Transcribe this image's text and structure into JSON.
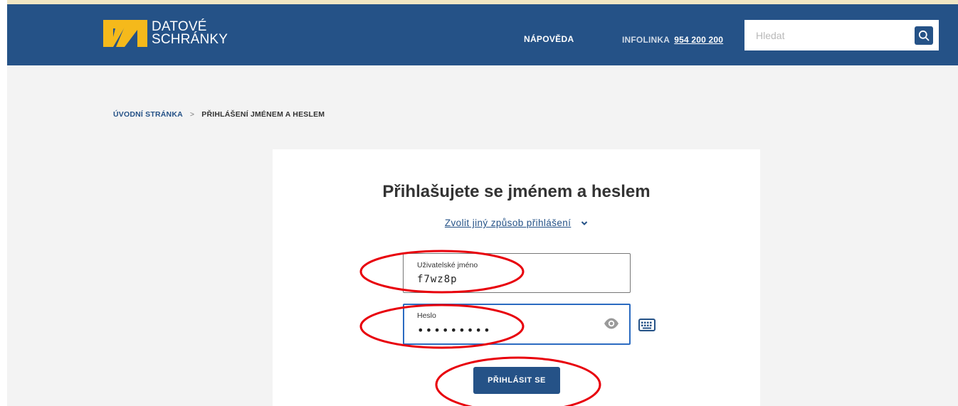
{
  "header": {
    "logo": {
      "line1": "DATOVÉ",
      "line2": "SCHRÁNKY",
      "icon": "datove-schranky-logo-icon"
    },
    "nav_help": "NÁPOVĚDA",
    "infoline_label": "INFOLINKA",
    "infoline_number": "954 200 200",
    "search": {
      "placeholder": "Hledat",
      "icon": "search-icon"
    }
  },
  "breadcrumb": {
    "home": "ÚVODNÍ STRÁNKA",
    "separator": ">",
    "current": "PŘIHLÁŠENÍ JMÉNEM A HESLEM"
  },
  "login": {
    "title_regular": "Přihlašujete se ",
    "title_bold": "jménem a heslem",
    "alt_login_link": "Zvolit jiný způsob přihlášení",
    "username": {
      "label": "Uživatelské jméno",
      "value": "f7wz8p"
    },
    "password": {
      "label": "Heslo",
      "value": "•••••••••"
    },
    "submit_label": "PŘIHLÁSIT SE"
  },
  "colors": {
    "header_bg": "#255287",
    "logo_yellow": "#f5b91b",
    "annotation_red": "#e8000b",
    "focus_border": "#2b6bc1"
  }
}
